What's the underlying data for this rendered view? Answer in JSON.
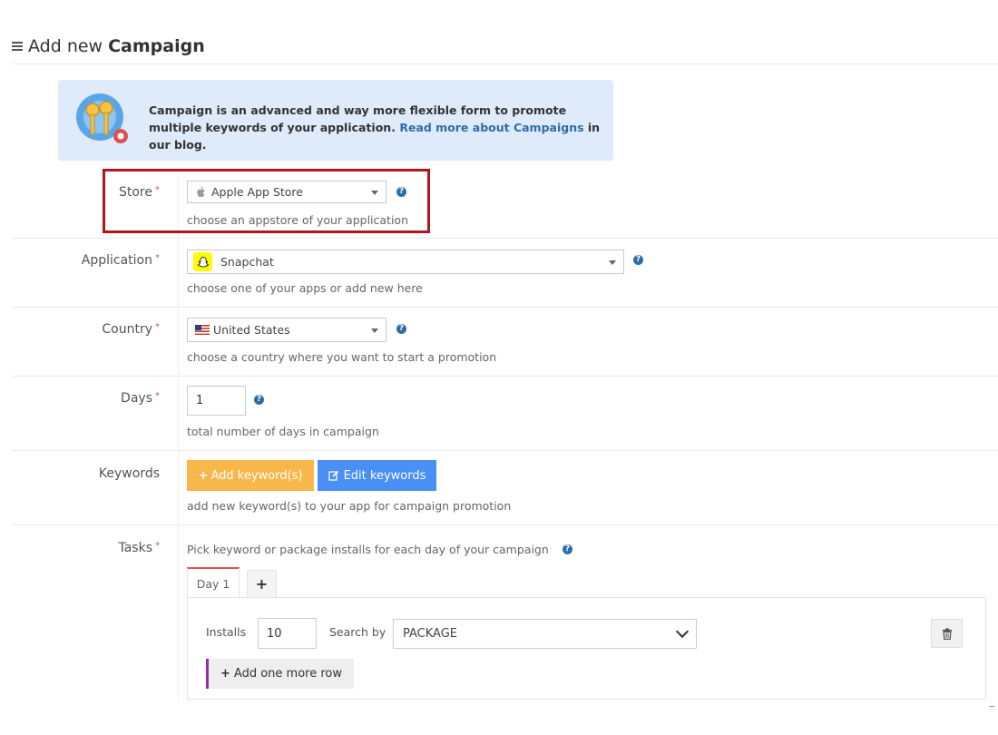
{
  "header": {
    "title_prefix": "Add new",
    "title_bold": "Campaign"
  },
  "info": {
    "text_part1": "Campaign is an advanced and way more flexible form to promote ",
    "text_bold": "multiple",
    "text_part2": " keywords of your application. ",
    "link_text": "Read more about Campaigns",
    "text_part3": " in our blog."
  },
  "form": {
    "required_mark": "*",
    "store": {
      "label": "Store",
      "value": "Apple App Store",
      "hint": "choose an appstore of your application",
      "icon": "apple-icon"
    },
    "application": {
      "label": "Application",
      "value": "Snapchat",
      "hint": "choose one of your apps or add new here",
      "icon": "snapchat-icon"
    },
    "country": {
      "label": "Country",
      "value": "United States",
      "hint": "choose a country where you want to start a promotion",
      "icon": "us-flag-icon"
    },
    "days": {
      "label": "Days",
      "value": "1",
      "hint": "total number of days in campaign"
    },
    "keywords": {
      "label": "Keywords",
      "add_button": "Add keyword(s)",
      "edit_button": "Edit keywords",
      "hint": "add new keyword(s) to your app for campaign promotion"
    },
    "tasks": {
      "label": "Tasks",
      "hint": "Pick keyword or package installs for each day of your campaign",
      "tabs": [
        {
          "label": "Day 1",
          "active": true
        }
      ],
      "add_tab": "+",
      "row": {
        "installs_label": "Installs",
        "installs_value": "10",
        "search_by_label": "Search by",
        "search_by_value": "PACKAGE"
      },
      "add_row_button": "Add one more row"
    }
  },
  "colors": {
    "info_bg": "#dfeafb",
    "highlight": "#b3141d",
    "required": "#d9534f",
    "warning_btn": "#f9b64a",
    "primary_btn": "#4a8ff6",
    "help": "#2f6da8",
    "add_row_accent": "#9c27b0"
  }
}
